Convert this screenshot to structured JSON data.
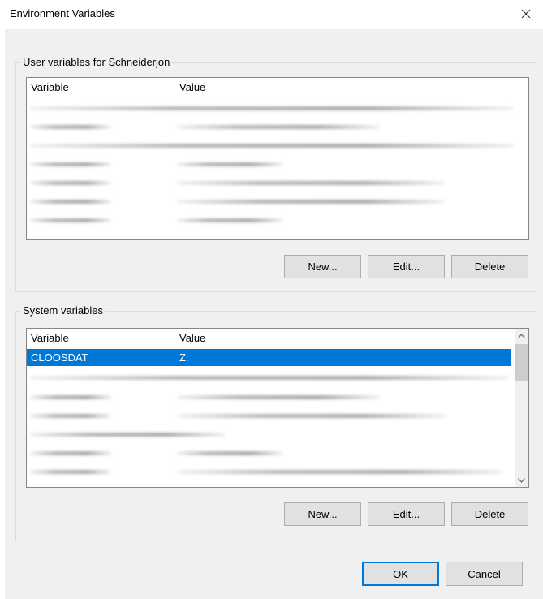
{
  "window": {
    "title": "Environment Variables"
  },
  "user_group": {
    "label": "User variables for Schneiderjon",
    "columns": [
      "Variable",
      "Value"
    ],
    "buttons": {
      "new": "New...",
      "edit": "Edit...",
      "delete": "Delete"
    }
  },
  "system_group": {
    "label": "System variables",
    "columns": [
      "Variable",
      "Value"
    ],
    "selected_row": {
      "variable": "CLOOSDAT",
      "value": "Z:"
    },
    "buttons": {
      "new": "New...",
      "edit": "Edit...",
      "delete": "Delete"
    }
  },
  "footer": {
    "ok": "OK",
    "cancel": "Cancel"
  },
  "colors": {
    "selection": "#0078d7",
    "dialog_bg": "#f0f0f0"
  }
}
